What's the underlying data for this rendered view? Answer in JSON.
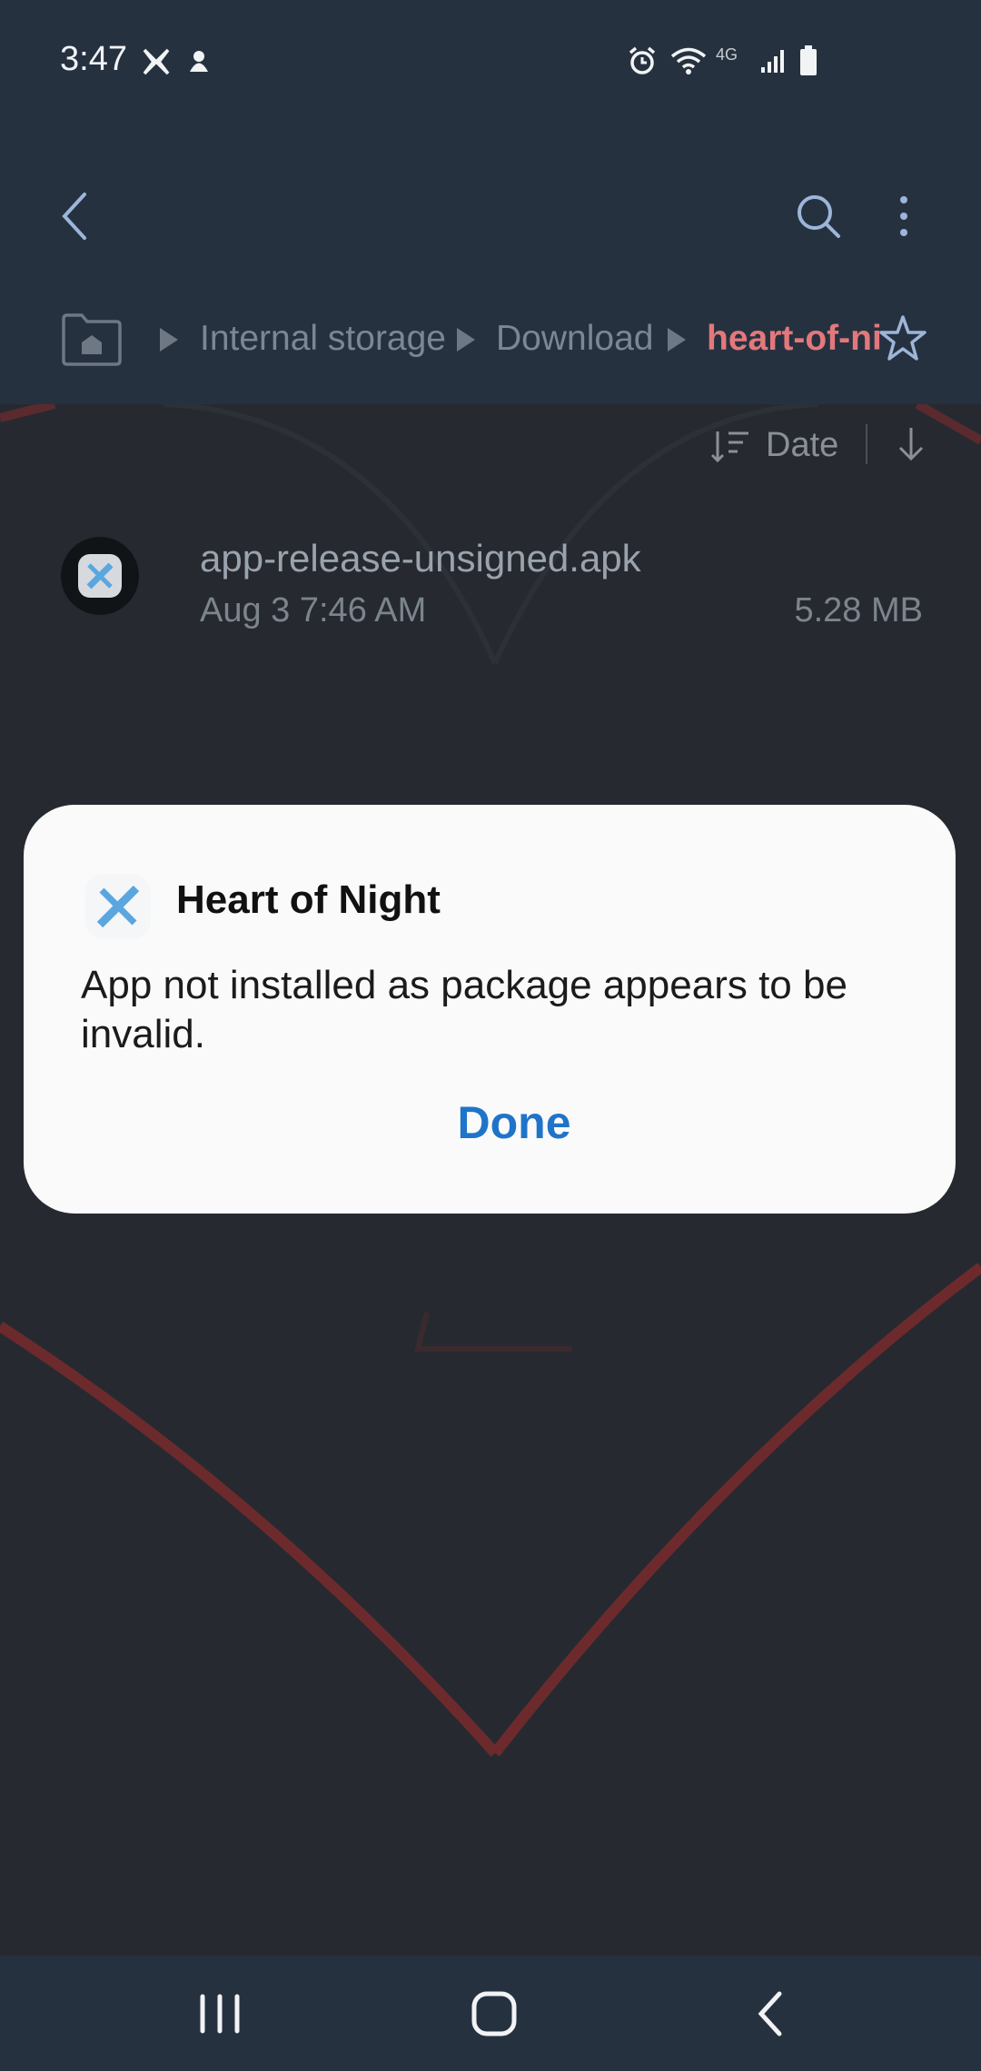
{
  "status_bar": {
    "time": "3:47",
    "network_label": "4G"
  },
  "app_bar": {
    "back_icon": "back-arrow-icon",
    "search_icon": "search-icon",
    "more_icon": "more-vert-icon"
  },
  "breadcrumb": {
    "items": [
      "Internal storage",
      "Download",
      "heart-of-ni"
    ],
    "active_color": "#e3787b"
  },
  "sort": {
    "label": "Date"
  },
  "files": [
    {
      "name": "app-release-unsigned.apk",
      "date": "Aug 3 7:46 AM",
      "size": "5.28 MB"
    }
  ],
  "dialog": {
    "title": "Heart of Night",
    "message": "App not installed as package appears to be invalid.",
    "button": "Done",
    "accent": "#1f74c9"
  },
  "nav": {
    "recents_icon": "recents-icon",
    "home_icon": "home-icon",
    "back_icon": "back-icon"
  }
}
